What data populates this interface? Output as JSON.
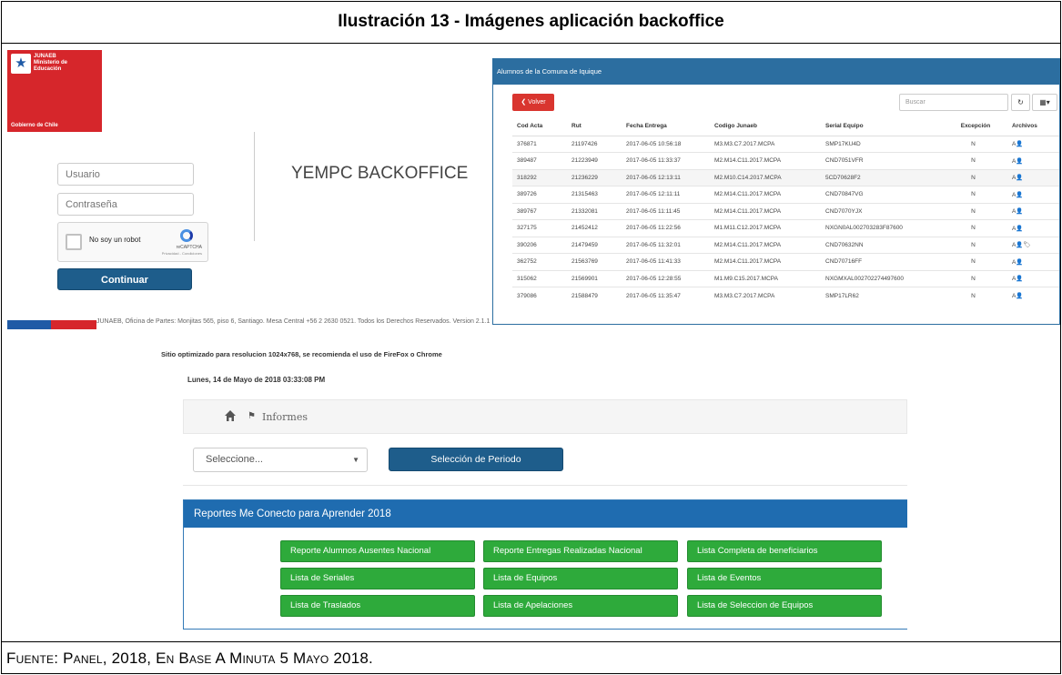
{
  "caption": "Ilustración 13 -  Imágenes aplicación backoffice",
  "source": "Fuente: Panel, 2018, En Base A Minuta 5 Mayo 2018.",
  "login": {
    "gov_top": "JUNAEB\nMinisterio de\nEducación",
    "gov_bottom": "Gobierno de Chile",
    "username_placeholder": "Usuario",
    "password_placeholder": "Contraseña",
    "captcha_label": "No soy un robot",
    "captcha_brand": "reCAPTCHA",
    "captcha_links": "Privacidad - Condiciones",
    "continue_label": "Continuar",
    "app_title": "YEMPC BACKOFFICE",
    "footer": "JUNAEB, Oficina de Partes: Monjitas 565, piso 6, Santiago. Mesa Central +56 2 2630 0521. Todos los Derechos Reservados. Version 2.1.1",
    "footer_note": "Sitio optimizado para resolucion 1024x768, se recomienda el uso de FireFox o Chrome",
    "colors": {
      "gov_red": "#d6262b",
      "gov_blue": "#1f5aa6",
      "button_blue": "#1e5d8b"
    }
  },
  "table_panel": {
    "title": "Alumnos de la Comuna de Iquique",
    "back_label": "❮ Volver",
    "search_placeholder": "Buscar",
    "columns": [
      "Cod Acta",
      "Rut",
      "Fecha Entrega",
      "Codigo Junaeb",
      "Serial Equipo",
      "Excepción",
      "Archivos"
    ],
    "rows": [
      [
        "376871",
        "21197426",
        "2017-06-05 10:56:18",
        "M3.M3.C7.2017.MCPA",
        "SMP17KU4D",
        "N",
        "A👤"
      ],
      [
        "389487",
        "21223949",
        "2017-06-05 11:33:37",
        "M2.M14.C11.2017.MCPA",
        "CND7051VFR",
        "N",
        "A👤"
      ],
      [
        "318292",
        "21236229",
        "2017-06-05 12:13:11",
        "M2.M10.C14.2017.MCPA",
        "5CD70628F2",
        "N",
        "A👤"
      ],
      [
        "389726",
        "21315463",
        "2017-06-05 12:11:11",
        "M2.M14.C11.2017.MCPA",
        "CND70847VG",
        "N",
        "A👤"
      ],
      [
        "389767",
        "21332081",
        "2017-06-05 11:11:45",
        "M2.M14.C11.2017.MCPA",
        "CND7070YJX",
        "N",
        "A👤"
      ],
      [
        "327175",
        "21452412",
        "2017-06-05 11:22:56",
        "M1.M11.C12.2017.MCPA",
        "NXGN0AL002703283F87600",
        "N",
        "A👤"
      ],
      [
        "390206",
        "21479459",
        "2017-06-05 11:32:01",
        "M2.M14.C11.2017.MCPA",
        "CND70632NN",
        "N",
        "A👤🏷"
      ],
      [
        "362752",
        "21563769",
        "2017-06-05 11:41:33",
        "M2.M14.C11.2017.MCPA",
        "CND70716FF",
        "N",
        "A👤"
      ],
      [
        "315062",
        "21569901",
        "2017-06-05 12:28:55",
        "M1.M9.C15.2017.MCPA",
        "NXGMXAL002702274497600",
        "N",
        "A👤"
      ],
      [
        "379086",
        "21588479",
        "2017-06-05 11:35:47",
        "M3.M3.C7.2017.MCPA",
        "SMP17LR62",
        "N",
        "A👤"
      ]
    ],
    "colors": {
      "header": "#2c6ea0",
      "back_button": "#d9352f"
    }
  },
  "reports": {
    "date": "Lunes, 14 de Mayo de 2018 03:33:08 PM",
    "breadcrumb_label": "Informes",
    "select_value": "Seleccione...",
    "period_button": "Selección de Periodo",
    "panel_title": "Reportes Me Conecto para Aprender 2018",
    "buttons": [
      "Reporte Alumnos Ausentes Nacional",
      "Reporte Entregas Realizadas Nacional",
      "Lista Completa de beneficiarios",
      "Lista de Seriales",
      "Lista de Equipos",
      "Lista de Eventos",
      "Lista de Traslados",
      "Lista de Apelaciones",
      "Lista de Seleccion de Equipos"
    ],
    "colors": {
      "panel_header": "#1f6cb0",
      "button_green": "#2eaa3b"
    }
  }
}
